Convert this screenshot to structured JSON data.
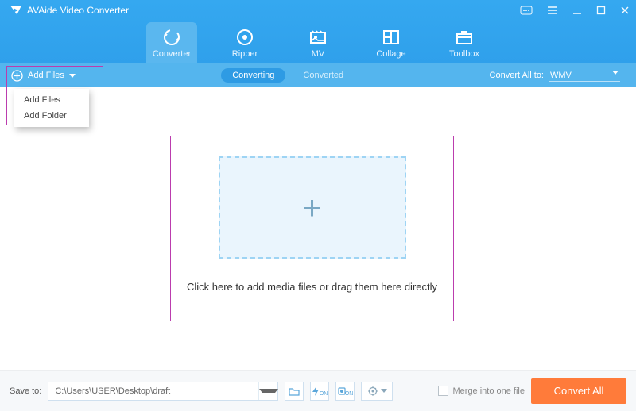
{
  "app": {
    "title": "AVAide Video Converter"
  },
  "nav": {
    "items": [
      {
        "label": "Converter"
      },
      {
        "label": "Ripper"
      },
      {
        "label": "MV"
      },
      {
        "label": "Collage"
      },
      {
        "label": "Toolbox"
      }
    ]
  },
  "subbar": {
    "add_files": "Add Files",
    "tabs": {
      "converting": "Converting",
      "converted": "Converted"
    },
    "convert_all_label": "Convert All to:",
    "format": "WMV"
  },
  "dropdown": {
    "add_files": "Add Files",
    "add_folder": "Add Folder"
  },
  "drop": {
    "hint": "Click here to add media files or drag them here directly"
  },
  "footer": {
    "save_to_label": "Save to:",
    "path": "C:\\Users\\USER\\Desktop\\draft",
    "merge_label": "Merge into one file",
    "convert_all": "Convert All"
  }
}
